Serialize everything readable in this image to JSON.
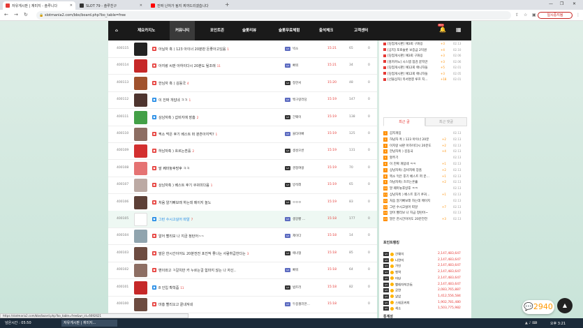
{
  "browser": {
    "tabs": [
      {
        "label": "자유게시판 | 재미지 - 솔루니다",
        "active": true,
        "color": "#e53935"
      },
      {
        "label": "SLOT 79 - 솔루친구",
        "active": false,
        "color": "#333333"
      },
      {
        "label": "진짜 난처가 됨지 찌까드리겠습니다",
        "active": false,
        "color": "#ff0000"
      }
    ],
    "new_tab": "+",
    "url": "slotmania2.com/bbs/board.php?bo_table=free",
    "paused_label": "일시중지됨",
    "status_url": "https://slotmaria2.com/bbs/board.php?bo_table=free&wr_id=6692621"
  },
  "site": {
    "nav": [
      "제요카지노",
      "커뮤니티",
      "포인트존",
      "슬롯리뷰",
      "슬롯무료체험",
      "출석체크",
      "고객센터"
    ],
    "active_nav": 1,
    "bell_count": "99+"
  },
  "posts": [
    {
      "num": "400115",
      "title": "아닐자 훅 ) 123 아이너 20분판 돈좋아고있음",
      "comments": "1",
      "author": "빅소",
      "time": "15:21",
      "views": "65",
      "thumb": "#222222",
      "icon": "#e53935",
      "level": "lv5",
      "lvcolor": "#5c6bc0",
      "highlight": false,
      "blue": false
    },
    {
      "num": "400114",
      "title": "아지랑 씨판 아하이다시 20분도 될조래",
      "comments": "11",
      "author": "빠워",
      "time": "15:21",
      "views": "34",
      "thumb": "#c62828",
      "icon": "#e53935",
      "level": "lv5",
      "lvcolor": "#5c6bc0",
      "highlight": false,
      "blue": false
    },
    {
      "num": "400113",
      "title": "한님자 훅 ) 김동국",
      "comments": "4",
      "author": "정한서",
      "time": "15:20",
      "views": "48",
      "thumb": "#a0522d",
      "icon": "#e53935",
      "level": "lv4",
      "lvcolor": "#333333",
      "highlight": false,
      "blue": false
    },
    {
      "num": "400112",
      "title": "이 진짜 개답네 ㅋㅋ",
      "comments": "1",
      "author": "백구랑러당",
      "time": "15:19",
      "views": "147",
      "thumb": "#4e342e",
      "icon": "#1e88e5",
      "level": "lv5",
      "lvcolor": "#5c6bc0",
      "highlight": false,
      "blue": false
    },
    {
      "num": "400111",
      "title": "상남자훅 ) 갑비지에 장흠",
      "comments": "2",
      "author": "간웨이",
      "time": "15:19",
      "views": "138",
      "thumb": "#43a047",
      "icon": "#1e88e5",
      "level": "lv3",
      "lvcolor": "#333333",
      "highlight": false,
      "blue": false
    },
    {
      "num": "400110",
      "title": "찍소 먹은 후기 베스트 퍼 분흔아지먹?",
      "comments": "1",
      "author": "울타아빠",
      "time": "15:19",
      "views": "125",
      "thumb": "#8d6e63",
      "icon": "#e53935",
      "level": "lv5",
      "lvcolor": "#5c6bc0",
      "highlight": false,
      "blue": false
    },
    {
      "num": "400109",
      "title": "하남자훅 ) 흐르는흔흘",
      "comments": "2",
      "author": "생성으번",
      "time": "15:19",
      "views": "131",
      "thumb": "#d32f2f",
      "icon": "#e53935",
      "level": "lv3",
      "lvcolor": "#333333",
      "highlight": false,
      "blue": false
    },
    {
      "num": "400108",
      "title": "말 꿰마놓후방후 ㅋㅋ",
      "comments": "",
      "author": "경정여왕",
      "time": "15:19",
      "views": "70",
      "thumb": "#e57373",
      "icon": "#e53935",
      "level": "lv3",
      "lvcolor": "#333333",
      "highlight": false,
      "blue": false
    },
    {
      "num": "400107",
      "title": "상남자훅 ) 베스트 후기 쿠귀미다음",
      "comments": "1",
      "author": "방석래",
      "time": "15:19",
      "views": "65",
      "thumb": "#bcaaa4",
      "icon": "#e53935",
      "level": "lv3",
      "lvcolor": "#333333",
      "highlight": false,
      "blue": false
    },
    {
      "num": "400106",
      "title": "처음 알기빠보래 하는데 메이지 놀노",
      "comments": "",
      "author": "ㅁㅁㅁ",
      "time": "15:19",
      "views": "83",
      "thumb": "#5d4037",
      "icon": "#e53935",
      "level": "lv3",
      "lvcolor": "#333333",
      "highlight": false,
      "blue": false
    },
    {
      "num": "400105",
      "title": "그런 수시고실어 따알",
      "comments": "7",
      "author": "생강빵 ...",
      "time": "15:18",
      "views": "177",
      "thumb": "#ffffff",
      "icon": "#1e88e5",
      "level": "lv5",
      "lvcolor": "#5c6bc0",
      "highlight": true,
      "blue": true
    },
    {
      "num": "400104",
      "title": "알어 빨리보 나 지금 정탄어~~",
      "comments": "",
      "author": "제이다",
      "time": "15:18",
      "views": "14",
      "thumb": "#90a4ae",
      "icon": "#e53935",
      "level": "lv5",
      "lvcolor": "#5c6bc0",
      "highlight": false,
      "blue": false
    },
    {
      "num": "400103",
      "title": "말은 한시간이어도 20분전전 포진적 좋나는 사람취급한다는",
      "comments": "3",
      "author": "에너형",
      "time": "15:18",
      "views": "85",
      "thumb": "#6d4c41",
      "icon": "#e53935",
      "level": "lv3",
      "lvcolor": "#333333",
      "highlight": false,
      "blue": false
    },
    {
      "num": "400102",
      "title": "맨이와고 ㅋ갈치만 카 누르는걸 힘마지 않는 나 자신..",
      "comments": "",
      "author": "빠워",
      "time": "15:18",
      "views": "64",
      "thumb": "#8d6e63",
      "icon": "#e53935",
      "level": "lv5",
      "lvcolor": "#5c6bc0",
      "highlight": false,
      "blue": false
    },
    {
      "num": "400101",
      "title": "8 인입 확학줌",
      "comments": "11",
      "author": "범트러",
      "time": "15:18",
      "views": "82",
      "thumb": "#c62828",
      "icon": "#1e88e5",
      "level": "lv3",
      "lvcolor": "#333333",
      "highlight": false,
      "blue": false
    },
    {
      "num": "400100",
      "title": "마흥 빨리오고 끝내져네",
      "comments": "",
      "author": "두중펄러한...",
      "time": "15:18",
      "views": "",
      "thumb": "#6d4c41",
      "icon": "#e53935",
      "level": "lv5",
      "lvcolor": "#5c6bc0",
      "highlight": false,
      "blue": false
    }
  ],
  "sidebar": {
    "notices": [
      {
        "title": "[당첨게시판] 얘3회 구화응",
        "count": "+3",
        "date": "02.13"
      },
      {
        "title": "[공지] 포로슬롯 보증금 2억원",
        "count": "+4",
        "date": "02.10"
      },
      {
        "title": "[당첨게시판] 얘3회 구화응",
        "count": "+3",
        "date": "02.06"
      },
      {
        "title": "[홍카카노] 시스템 점검 끝지만",
        "count": "+3",
        "date": "02.06"
      },
      {
        "title": "[당첨게시판] 얘12회 애니자들",
        "count": "+5",
        "date": "02.01"
      },
      {
        "title": "[당첨게시판] 얘12회 애니자들",
        "count": "+3",
        "date": "02.05"
      },
      {
        "title": "[선물상자] 목서명결 루프 지...",
        "count": "+18",
        "date": "02.01"
      }
    ],
    "tab_recent": "최근 글",
    "tab_comments": "최근 댓글",
    "recent": [
      {
        "n": "1",
        "title": "갑지개임",
        "count": "",
        "date": "02.13"
      },
      {
        "n": "2",
        "title": "하남자 훅 ) 123 아이너 20분",
        "count": "+2",
        "date": "02.13"
      },
      {
        "n": "3",
        "title": "이지랑 씨판 아하이다시 20분도",
        "count": "+2",
        "date": "02.13"
      },
      {
        "n": "4",
        "title": "한남자훅 ) 김동국",
        "count": "+4",
        "date": "02.13"
      },
      {
        "n": "5",
        "title": "할주기",
        "count": "",
        "date": "02.13"
      },
      {
        "n": "6",
        "title": "이 진짜 개답네 ㅋㅋ",
        "count": "+1",
        "date": "02.13"
      },
      {
        "n": "7",
        "title": "상남자훅) 갑비지에 장흠",
        "count": "+2",
        "date": "02.13"
      },
      {
        "n": "8",
        "title": "찍소 먹은 후기 베스트 퍼 분...",
        "count": "+1",
        "date": "02.13"
      },
      {
        "n": "9",
        "title": "하남자훅) 흐르는흔흘",
        "count": "+2",
        "date": "02.13"
      },
      {
        "n": "10",
        "title": "말 꿰마놓후방후 ㅋㅋ",
        "count": "",
        "date": "02.13"
      },
      {
        "n": "11",
        "title": "상남자훅 ) 베스트 후기 쿠귀...",
        "count": "+1",
        "date": "02.13"
      },
      {
        "n": "12",
        "title": "처음 알기빠보래 하는데 메이지",
        "count": "",
        "date": "02.13"
      },
      {
        "n": "13",
        "title": "그런 수시고실어 따알",
        "count": "+7",
        "date": "02.13"
      },
      {
        "n": "14",
        "title": "알어 빨리보 나 지금 정탄어~",
        "count": "",
        "date": "02.13"
      },
      {
        "n": "15",
        "title": "말은 한시간이어도 20분전전",
        "count": "+3",
        "date": "02.13"
      }
    ],
    "point_title": "포인트랭킹",
    "points": [
      {
        "lv": "lv5",
        "name": "간웨이",
        "val": "2,147,483,647"
      },
      {
        "lv": "lv5",
        "name": "나연이",
        "val": "2,147,483,647"
      },
      {
        "lv": "lv4",
        "name": "가인",
        "val": "2,147,483,647"
      },
      {
        "lv": "lv4",
        "name": "정혁",
        "val": "2,147,483,647"
      },
      {
        "lv": "lv5",
        "name": "아탄",
        "val": "2,147,483,647"
      },
      {
        "lv": "lv5",
        "name": "빨래자작간돔",
        "val": "2,147,483,647"
      },
      {
        "lv": "lv5",
        "name": "공연",
        "val": "2,083,765,887"
      },
      {
        "lv": "lv5",
        "name": "알았",
        "val": "1,412,556,584"
      },
      {
        "lv": "lv5",
        "name": "스테폰커피",
        "val": "1,902,781,480"
      },
      {
        "lv": "lv5",
        "name": "색소",
        "val": "1,503,775,982"
      }
    ],
    "bottom_label": "통계성"
  },
  "chat_count": "2940",
  "taskbar": {
    "items": [
      "넘은시간 : 05:50",
      "자유게시판 | 재미지..."
    ],
    "clock": "오후 3:21"
  }
}
